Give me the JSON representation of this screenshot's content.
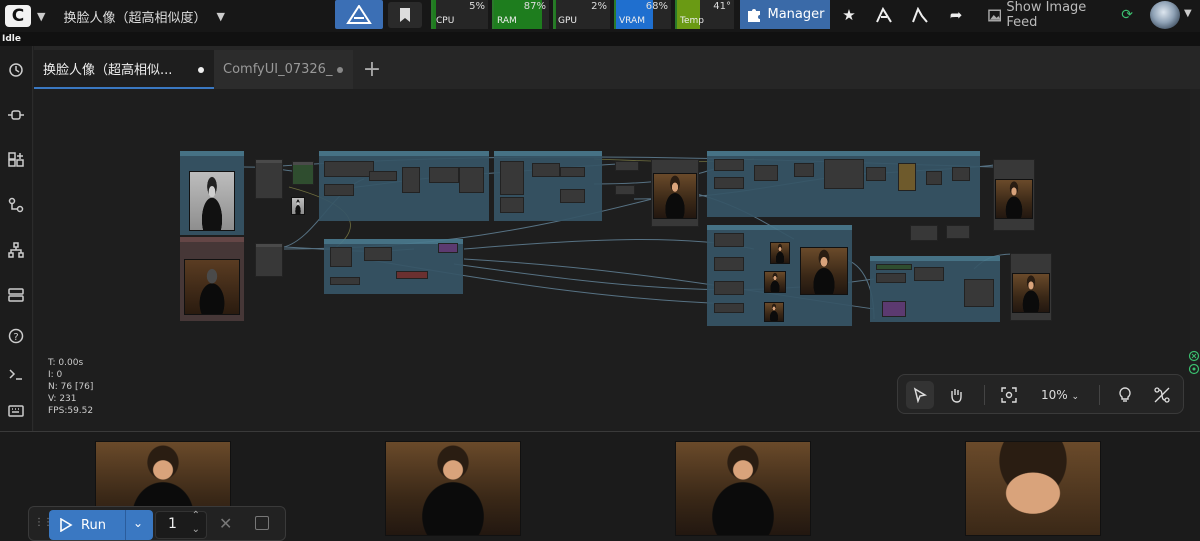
{
  "topbar": {
    "workflow_title": "换脸人像（超高相似度）",
    "manager_label": "Manager",
    "show_feed_label": "Show Image Feed"
  },
  "monitors": [
    {
      "label": "CPU",
      "percent": 5,
      "value_text": "5%",
      "color": "#1e7d1e"
    },
    {
      "label": "RAM",
      "percent": 87,
      "value_text": "87%",
      "color": "#1e7d1e"
    },
    {
      "label": "GPU",
      "percent": 2,
      "value_text": "2%",
      "color": "#1e7d1e"
    },
    {
      "label": "VRAM",
      "percent": 68,
      "value_text": "68%",
      "color": "#1f6fcf"
    },
    {
      "label": "Temp",
      "percent": 41,
      "value_text": "41°",
      "color": "#6a9a14"
    }
  ],
  "status": "Idle",
  "tabs": [
    {
      "label": "换脸人像（超高相似...",
      "active": true
    },
    {
      "label": "ComfyUI_07326_",
      "active": false
    }
  ],
  "stats": {
    "t": "T: 0.00s",
    "i": "I: 0",
    "n": "N: 76 [76]",
    "v": "V: 231",
    "fps": "FPS:59.52"
  },
  "canvas_toolbar": {
    "zoom": "10%"
  },
  "runbar": {
    "run_label": "Run",
    "batch_count": "1"
  },
  "colors": {
    "accent": "#3a78c2",
    "group_fill": "#365566"
  }
}
